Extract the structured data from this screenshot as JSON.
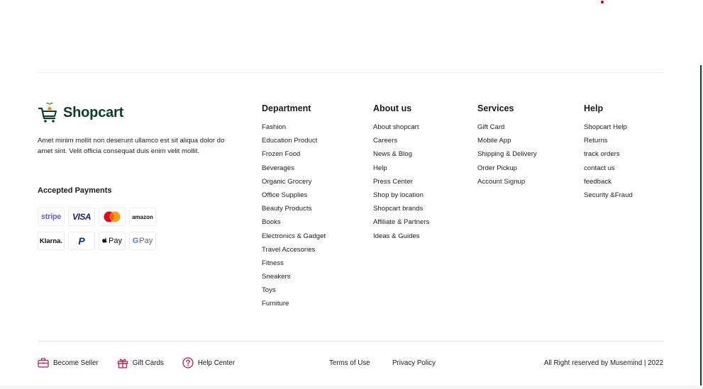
{
  "brand": {
    "name": "Shopcart",
    "color": "#0b3d2e"
  },
  "about": {
    "text": "Amet minim mollit non deserunt ullamco est sit aliqua dolor do amet sint. Velit officia consequat duis enim velit mollit."
  },
  "payments": {
    "title": "Accepted Payments",
    "methods": [
      {
        "name": "stripe",
        "label": "stripe",
        "icon": "stripe-icon"
      },
      {
        "name": "visa",
        "label": "VISA",
        "icon": "visa-icon"
      },
      {
        "name": "mastercard",
        "icon": "mastercard-icon"
      },
      {
        "name": "amazon",
        "label": "amazon",
        "icon": "amazon-icon"
      },
      {
        "name": "klarna",
        "label": "Klarna.",
        "icon": "klarna-icon"
      },
      {
        "name": "paypal",
        "label": "P",
        "icon": "paypal-icon"
      },
      {
        "name": "applepay",
        "label": "Pay",
        "icon": "apple-pay-icon"
      },
      {
        "name": "googlepay",
        "label": "Pay",
        "icon": "google-pay-icon"
      }
    ]
  },
  "columns": [
    {
      "title": "Department",
      "items": [
        "Fashion",
        "Education Product",
        "Frozen Food",
        "Beverages",
        "Organic Grocery",
        "Office Supplies",
        "Beauty Products",
        "Books",
        "Electronics & Gadget",
        "Travel Accesories",
        "Fitness",
        "Sneakers",
        "Toys",
        "Furniture"
      ]
    },
    {
      "title": "About us",
      "items": [
        "About shopcart",
        "Careers",
        "News & Blog",
        "Help",
        "Press Center",
        "Shop by location",
        "Shopcart brands",
        "Affiliate & Partners",
        "Ideas & Guides"
      ]
    },
    {
      "title": "Services",
      "items": [
        "Gift Card",
        "Mobile App",
        "Shipping & Delivery",
        "Order Pickup",
        "Account Signup"
      ]
    },
    {
      "title": "Help",
      "items": [
        "Shopcart Help",
        "Returns",
        "track orders",
        "contact us",
        "feedback",
        "Security &Fraud"
      ]
    }
  ],
  "bottom": {
    "links": [
      {
        "label": "Become Seller",
        "icon": "briefcase-icon"
      },
      {
        "label": "Gift Cards",
        "icon": "gift-icon"
      },
      {
        "label": "Help Center",
        "icon": "question-circle-icon"
      }
    ],
    "terms": "Terms of Use",
    "privacy": "Privacy Policy",
    "copyright": "All Right reserved by Musemind | 2022",
    "icon_color": "#c2185b"
  }
}
